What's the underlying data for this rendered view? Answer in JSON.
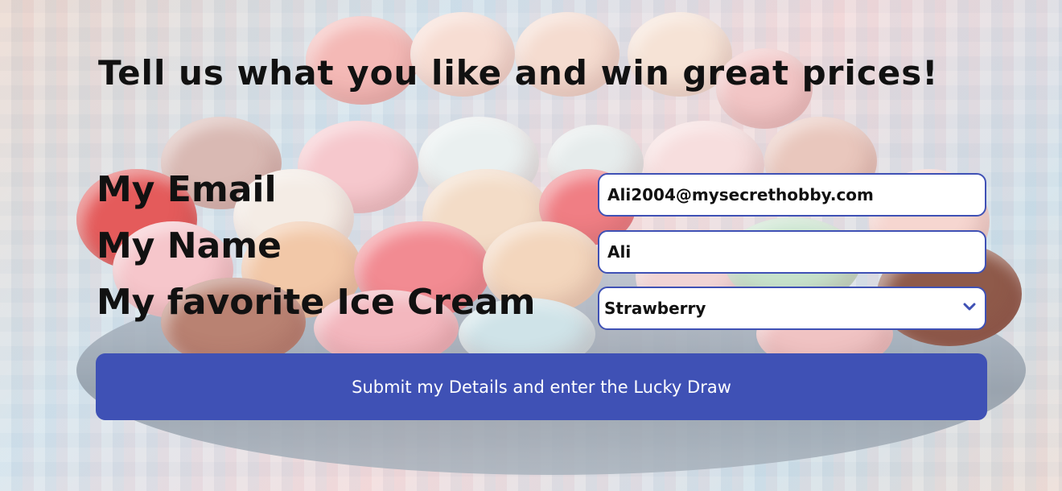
{
  "heading": "Tell us what you like and win great prices!",
  "form": {
    "email_label": "My Email",
    "email_value": "Ali2004@mysecrethobby.com",
    "name_label": "My Name",
    "name_value": "Ali",
    "icecream_label": "My favorite Ice Cream",
    "icecream_selected": "Strawberry",
    "submit_label": "Submit my Details and enter the Lucky Draw"
  },
  "colors": {
    "accent": "#3f51b5",
    "field_bg": "#ffffff",
    "text": "#111111"
  },
  "icons": {
    "dropdown": "chevron-down-icon"
  }
}
